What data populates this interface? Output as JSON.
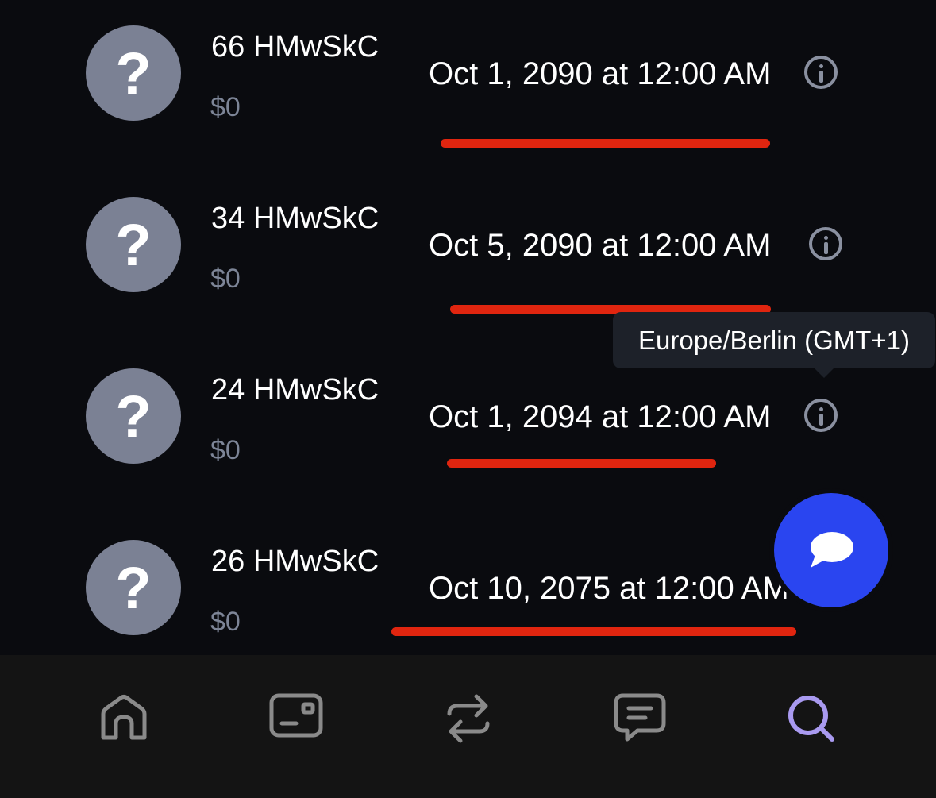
{
  "items": [
    {
      "name": "66 HMwSkC",
      "amount": "$0",
      "date": "Oct 1, 2090 at 12:00 AM",
      "avatar": "?"
    },
    {
      "name": "34 HMwSkC",
      "amount": "$0",
      "date": "Oct 5, 2090 at 12:00 AM",
      "avatar": "?"
    },
    {
      "name": "24 HMwSkC",
      "amount": "$0",
      "date": "Oct 1, 2094 at 12:00 AM",
      "avatar": "?"
    },
    {
      "name": "26 HMwSkC",
      "amount": "$0",
      "date": "Oct 10, 2075 at 12:00 AM",
      "avatar": "?"
    }
  ],
  "tooltip": {
    "text": "Europe/Berlin (GMT+1)"
  },
  "tabbar": {
    "tabs": [
      {
        "icon": "home-icon"
      },
      {
        "icon": "wallet-card-icon"
      },
      {
        "icon": "swap-arrows-icon"
      },
      {
        "icon": "message-icon"
      },
      {
        "icon": "search-icon",
        "active": true
      }
    ],
    "active_color": "#a99af0",
    "inactive_color": "#8a8a8a"
  },
  "fab": {
    "icon": "chat-bubble-icon",
    "color": "#2a45f0"
  },
  "annotation_color": "#e0250f"
}
